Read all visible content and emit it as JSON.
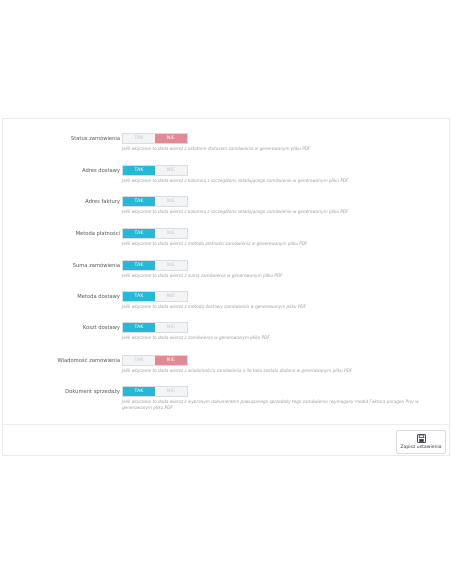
{
  "settings": [
    {
      "label": "Status zamówienia",
      "on": "TAK",
      "off": "NIE",
      "value": "NIE",
      "help": "Jeśli włączone to doda wiersz z ostatnim statusem zamówienia w generowanym pliku PDF"
    },
    {
      "label": "Adres dostawy",
      "on": "TAK",
      "off": "NIE",
      "value": "TAK",
      "help": "Jeśli włączone to doda wiersz z kolumną z szczegółami składającego zamówienie w generowanym pliku PDF"
    },
    {
      "label": "Adres faktury",
      "on": "TAK",
      "off": "NIE",
      "value": "TAK",
      "help": "Jeśli włączone to doda wiersz z kolumną z szczegółami składającego zamówienie w generowanym pliku PDF"
    },
    {
      "label": "Metoda płatności",
      "on": "TAK",
      "off": "NIE",
      "value": "TAK",
      "help": "Jeśli włączone to doda wiersz z metodą płatności zamówienia w generowanym pliku PDF"
    },
    {
      "label": "Suma zamówienia",
      "on": "TAK",
      "off": "NIE",
      "value": "TAK",
      "help": "Jeśli włączone to doda wiersz z sumą zamówienia w generowanym pliku PDF"
    },
    {
      "label": "Metoda dostawy",
      "on": "TAK",
      "off": "NIE",
      "value": "TAK",
      "help": "Jeśli włączone to doda wiersz z metodą dostawy zamówienia w generowanym pliku PDF"
    },
    {
      "label": "Koszt dostawy",
      "on": "TAK",
      "off": "NIE",
      "value": "TAK",
      "help": "Jeśli włączone to doda wiersz z zamówienia w generowanym pliku PDF"
    },
    {
      "label": "Wiadomość zamówienia",
      "on": "TAK",
      "off": "NIE",
      "value": "NIE",
      "help": "Jeśli włączone to doda wiersz z wiadomością zamówienia o ile taka została dodana w generowanym pliku PDF"
    },
    {
      "label": "Dokument sprzedaży",
      "on": "TAK",
      "off": "NIE",
      "value": "TAK",
      "help": "Jeśli włączone to doda wiersz z wybranym dokumentem powiązanego sprzedaży tego zamówienia (wymagany moduł Faktura paragon Pro) w generowanym pliku PDF"
    }
  ],
  "footer": {
    "save_label": "Zapisz ustawienia",
    "save_icon": "floppy-disk-icon"
  },
  "colors": {
    "tak_active": "#25b9d7",
    "nie_active": "#e08a95"
  }
}
